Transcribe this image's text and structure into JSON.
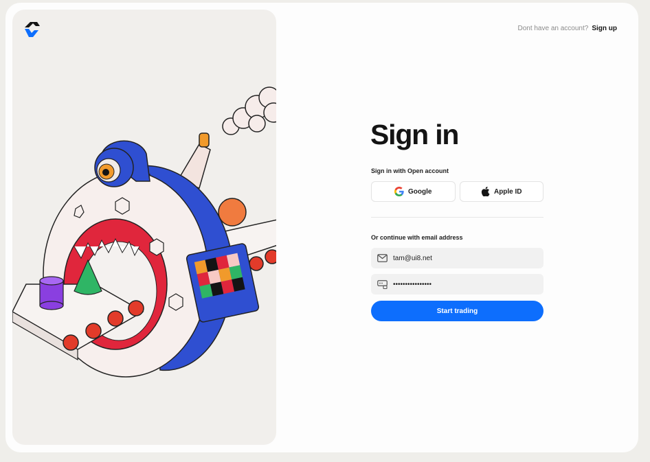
{
  "header": {
    "signup_prompt": "Dont have an account?",
    "signup_link": "Sign up"
  },
  "form": {
    "title": "Sign in",
    "open_account_label": "Sign in with Open account",
    "google_label": "Google",
    "apple_label": "Apple ID",
    "email_section_label": "Or continue with email address",
    "email_value": "tam@ui8.net",
    "password_value": "••••••••••••••••",
    "submit_label": "Start trading"
  },
  "icons": {
    "logo": "brand-logo-icon",
    "google": "google-icon",
    "apple": "apple-icon",
    "email": "mail-icon",
    "password": "password-icon"
  },
  "colors": {
    "primary": "#0D6EFD",
    "background": "#EFEEEA",
    "art_panel": "#F1EFEC",
    "text": "#141414"
  }
}
